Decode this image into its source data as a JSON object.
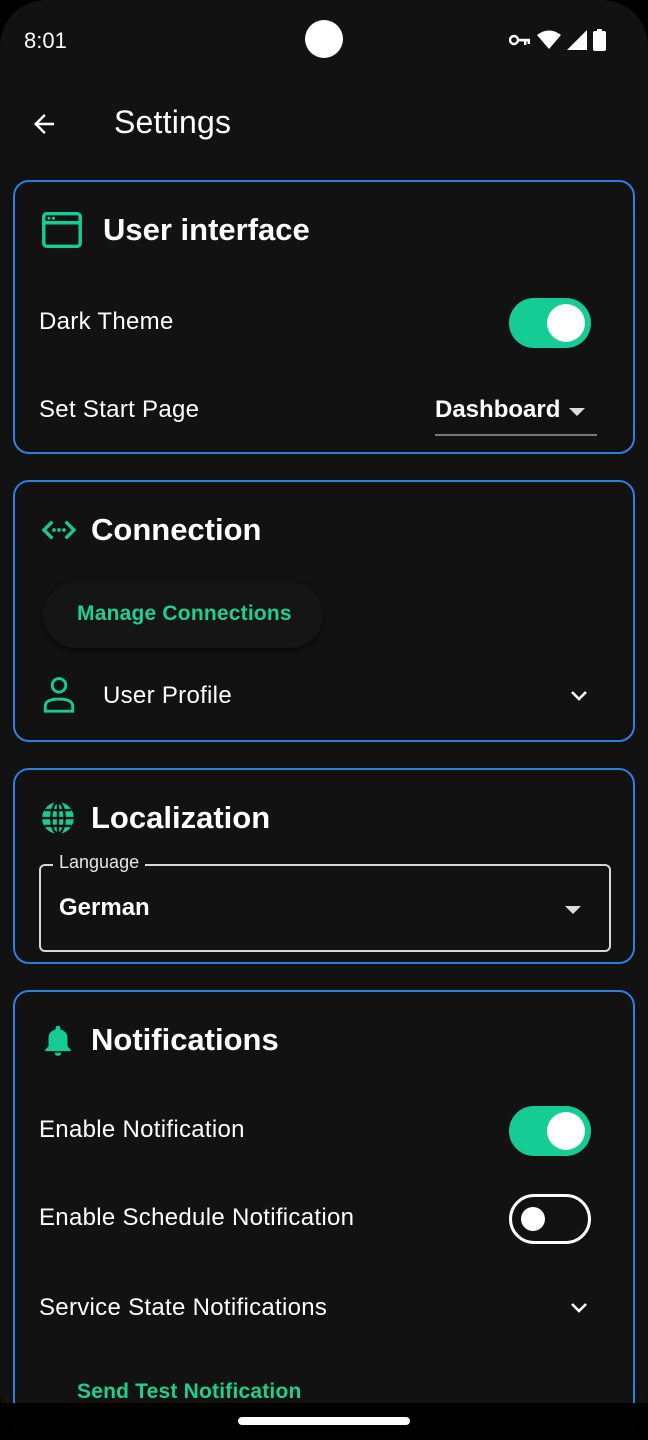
{
  "status_bar": {
    "time": "8:01"
  },
  "app_bar": {
    "title": "Settings"
  },
  "user_interface": {
    "title": "User interface",
    "dark_theme_label": "Dark Theme",
    "dark_theme_on": true,
    "start_page_label": "Set Start Page",
    "start_page_value": "Dashboard"
  },
  "connection": {
    "title": "Connection",
    "manage_button": "Manage Connections",
    "user_profile_label": "User Profile"
  },
  "localization": {
    "title": "Localization",
    "language_label": "Language",
    "language_value": "German"
  },
  "notifications": {
    "title": "Notifications",
    "enable_label": "Enable Notification",
    "enable_on": true,
    "schedule_label": "Enable Schedule Notification",
    "schedule_on": false,
    "service_state_label": "Service State Notifications",
    "send_test_button": "Send Test Notification"
  },
  "colors": {
    "accent": "#14cc94",
    "card_border": "#2f7fe0",
    "background": "#121212"
  },
  "icons": {
    "back": "arrow-left-icon",
    "user_interface": "browser-window-icon",
    "connection": "code-arrows-icon",
    "user_profile": "person-outline-icon",
    "localization": "globe-icon",
    "notifications": "bell-icon"
  }
}
